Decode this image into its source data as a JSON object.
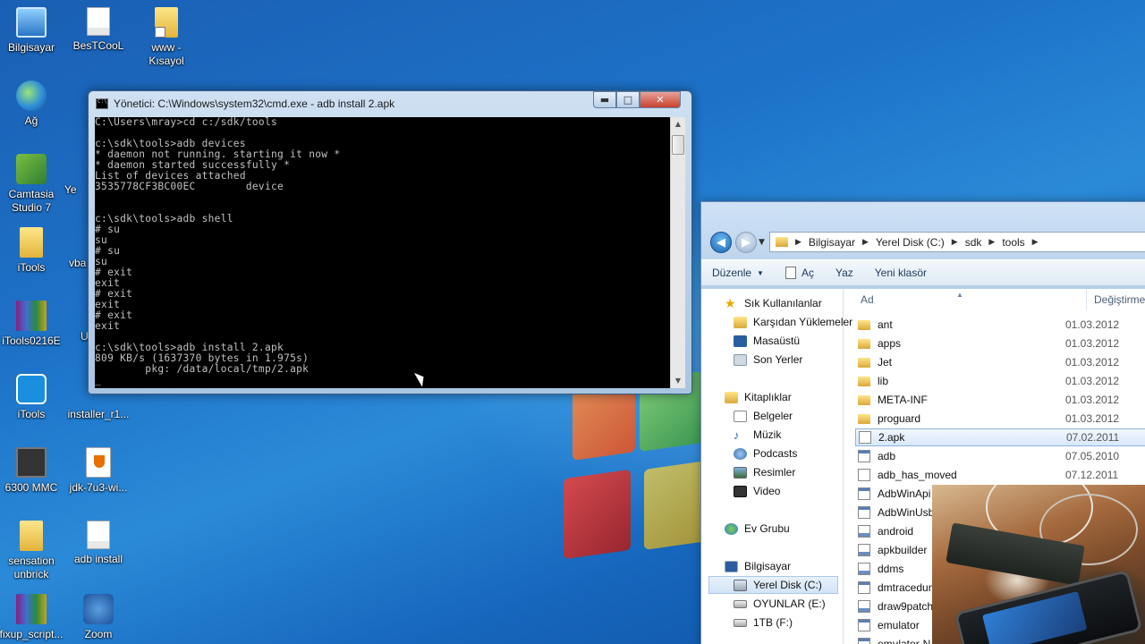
{
  "desktop": {
    "icons": [
      {
        "label": "Bilgisayar",
        "icon": "computer-icon"
      },
      {
        "label": "BesTCooL",
        "icon": "document-icon"
      },
      {
        "label": "www -\nKısayol",
        "icon": "shortcut-folder-icon"
      },
      {
        "label": "Ağ",
        "icon": "network-icon"
      },
      {
        "label": "Camtasia\nStudio 7",
        "icon": "camtasia-icon"
      },
      {
        "label": "iTools",
        "icon": "folder-icon"
      },
      {
        "label": "iTools0216E",
        "icon": "winrar-icon"
      },
      {
        "label": "iTools",
        "icon": "itools-icon"
      },
      {
        "label": "installer_r1...",
        "icon": "installer-icon"
      },
      {
        "label": "6300 MMC",
        "icon": "chip-icon"
      },
      {
        "label": "jdk-7u3-wi...",
        "icon": "java-icon"
      },
      {
        "label": "sensation\nunbrick",
        "icon": "folder-icon"
      },
      {
        "label": "adb install",
        "icon": "document-icon"
      },
      {
        "label": "fixup_script...",
        "icon": "winrar-icon"
      },
      {
        "label": "Zoom",
        "icon": "zoom-icon"
      }
    ],
    "partial_labels": [
      "Ye",
      "vba",
      "U"
    ]
  },
  "cmd": {
    "title": "Yönetici: C:\\Windows\\system32\\cmd.exe - adb  install 2.apk",
    "lines": "C:\\Users\\mray>cd c:/sdk/tools\n\nc:\\sdk\\tools>adb devices\n* daemon not running. starting it now *\n* daemon started successfully *\nList of devices attached\n3535778CF3BC00EC        device\n\n\nc:\\sdk\\tools>adb shell\n# su\nsu\n# su\nsu\n# exit\nexit\n# exit\nexit\n# exit\nexit\n\nc:\\sdk\\tools>adb install 2.apk\n809 KB/s (1637370 bytes in 1.975s)\n        pkg: /data/local/tmp/2.apk\n_",
    "min_glyph": "▬",
    "max_glyph": "□",
    "close_glyph": "✕"
  },
  "explorer": {
    "breadcrumb": [
      "Bilgisayar",
      "Yerel Disk (C:)",
      "sdk",
      "tools"
    ],
    "toolbar": {
      "organize": "Düzenle",
      "open": "Aç",
      "write": "Yaz",
      "new_folder": "Yeni klasör"
    },
    "columns": {
      "name": "Ad",
      "date": "Değiştirme"
    },
    "nav": [
      {
        "label": "Sık Kullanılanlar",
        "icon": "star-icon"
      },
      {
        "label": "Karşıdan Yüklemeler",
        "icon": "downloads-icon"
      },
      {
        "label": "Masaüstü",
        "icon": "desktop-icon"
      },
      {
        "label": "Son Yerler",
        "icon": "recent-icon"
      },
      {
        "label": "Kitaplıklar",
        "icon": "libraries-icon"
      },
      {
        "label": "Belgeler",
        "icon": "documents-icon"
      },
      {
        "label": "Müzik",
        "icon": "music-icon"
      },
      {
        "label": "Podcasts",
        "icon": "podcast-icon"
      },
      {
        "label": "Resimler",
        "icon": "pictures-icon"
      },
      {
        "label": "Video",
        "icon": "video-icon"
      },
      {
        "label": "Ev Grubu",
        "icon": "homegroup-icon"
      },
      {
        "label": "Bilgisayar",
        "icon": "computer-icon"
      },
      {
        "label": "Yerel Disk (C:)",
        "icon": "drive-icon"
      },
      {
        "label": "OYUNLAR (E:)",
        "icon": "drive-icon"
      },
      {
        "label": "1TB (F:)",
        "icon": "drive-icon"
      }
    ],
    "files": [
      {
        "name": "ant",
        "date": "01.03.2012",
        "type": "folder"
      },
      {
        "name": "apps",
        "date": "01.03.2012",
        "type": "folder"
      },
      {
        "name": "Jet",
        "date": "01.03.2012",
        "type": "folder"
      },
      {
        "name": "lib",
        "date": "01.03.2012",
        "type": "folder"
      },
      {
        "name": "META-INF",
        "date": "01.03.2012",
        "type": "folder"
      },
      {
        "name": "proguard",
        "date": "01.03.2012",
        "type": "folder"
      },
      {
        "name": "2.apk",
        "date": "07.02.2011",
        "type": "file"
      },
      {
        "name": "adb",
        "date": "07.05.2010",
        "type": "exe"
      },
      {
        "name": "adb_has_moved",
        "date": "07.12.2011",
        "type": "file"
      },
      {
        "name": "AdbWinApi",
        "date": "",
        "type": "exe"
      },
      {
        "name": "AdbWinUsb",
        "date": "",
        "type": "exe"
      },
      {
        "name": "android",
        "date": "",
        "type": "bat"
      },
      {
        "name": "apkbuilder",
        "date": "",
        "type": "bat"
      },
      {
        "name": "ddms",
        "date": "",
        "type": "bat"
      },
      {
        "name": "dmtracedump",
        "date": "",
        "type": "exe"
      },
      {
        "name": "draw9patch",
        "date": "",
        "type": "bat"
      },
      {
        "name": "emulator",
        "date": "",
        "type": "exe"
      },
      {
        "name": "emulator-N",
        "date": "",
        "type": "exe"
      }
    ]
  }
}
